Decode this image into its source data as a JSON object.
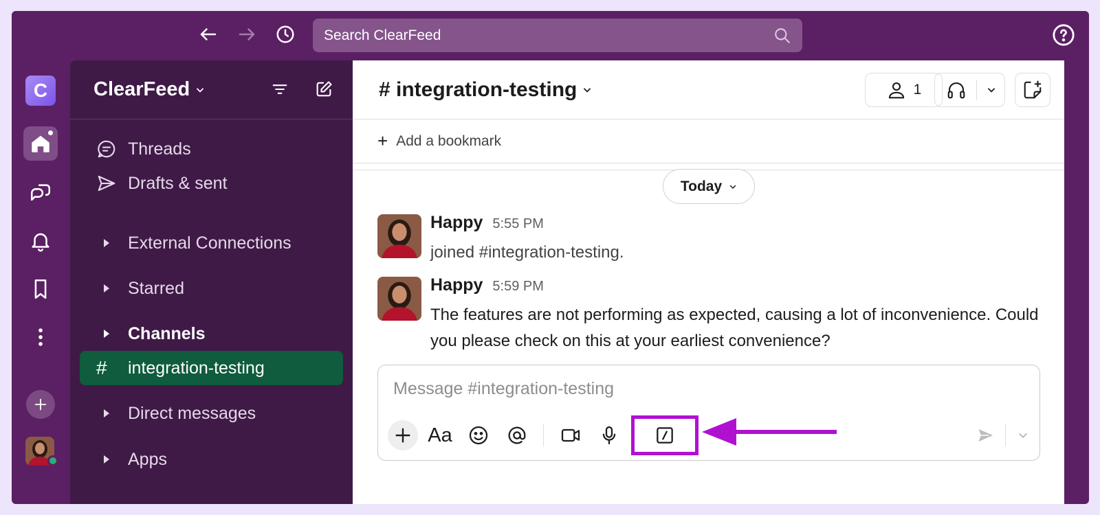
{
  "workspace": {
    "name": "ClearFeed",
    "initial": "C"
  },
  "search": {
    "placeholder": "Search ClearFeed"
  },
  "sidebar": {
    "title": "ClearFeed",
    "items": [
      {
        "label": "Threads",
        "icon": "threads-icon"
      },
      {
        "label": "Drafts & sent",
        "icon": "send-icon"
      },
      {
        "label": "External Connections",
        "icon": "caret-right-icon"
      },
      {
        "label": "Starred",
        "icon": "caret-right-icon"
      },
      {
        "label": "Channels",
        "icon": "caret-right-icon"
      },
      {
        "label": "integration-testing",
        "icon": "hash-icon"
      },
      {
        "label": "Direct messages",
        "icon": "caret-right-icon"
      },
      {
        "label": "Apps",
        "icon": "caret-right-icon"
      }
    ]
  },
  "channel": {
    "name": "# integration-testing",
    "member_count": "1",
    "bookmark_label": "Add a bookmark",
    "date_divider": "Today"
  },
  "messages": [
    {
      "author": "Happy",
      "time": "5:55 PM",
      "text": "joined #integration-testing."
    },
    {
      "author": "Happy",
      "time": "5:59 PM",
      "text": "The features are not performing as expected, causing a lot of inconvenience. Could you please check on this at your earliest convenience?"
    }
  ],
  "composer": {
    "placeholder": "Message #integration-testing",
    "format_label": "Aa"
  },
  "colors": {
    "aubergine": "#5b1f63",
    "sidebar": "#3f1a47",
    "selected_channel": "#0f5c3e",
    "highlight": "#b011d1"
  }
}
